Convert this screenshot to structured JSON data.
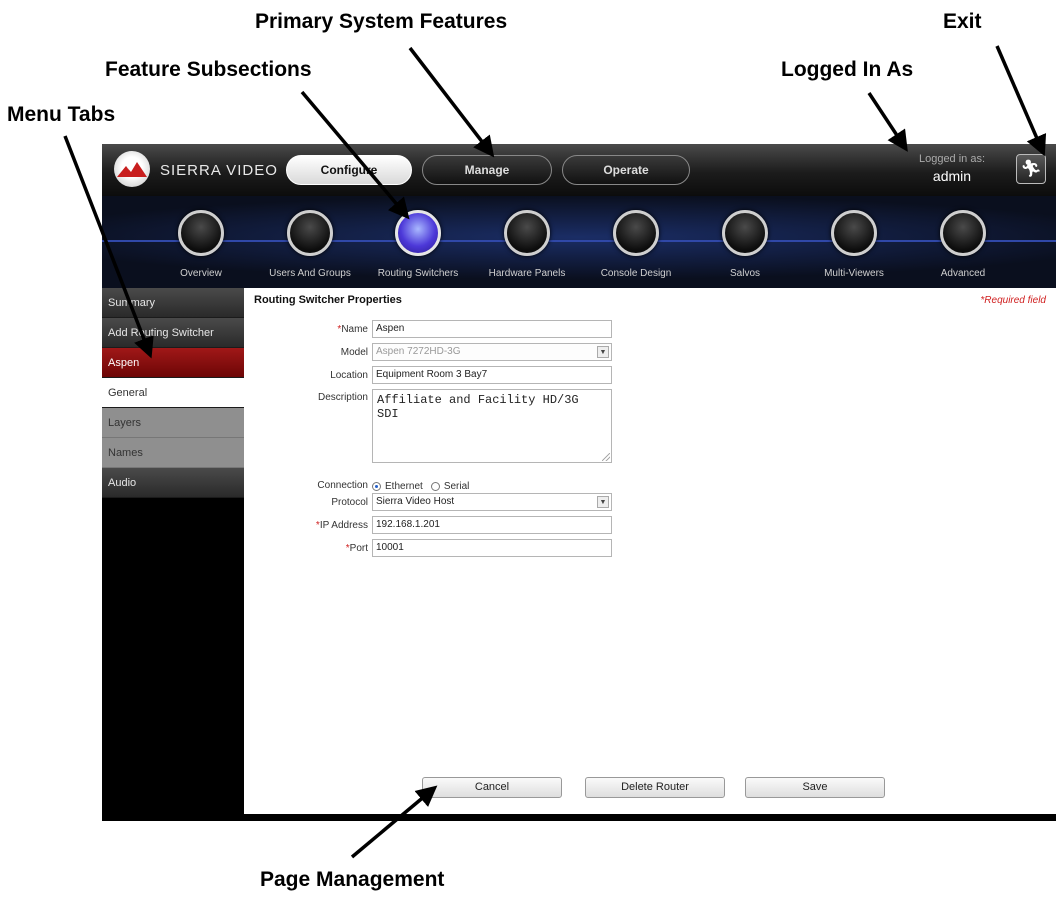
{
  "annotations": {
    "primary_features": "Primary System Features",
    "exit": "Exit",
    "feature_subsections": "Feature Subsections",
    "logged_in_as": "Logged In As",
    "menu_tabs": "Menu Tabs",
    "page_management": "Page Management"
  },
  "header": {
    "brand": "SIERRA VIDEO",
    "logo_icon": "sierra-video-logo",
    "nav": [
      {
        "label": "Configure",
        "active": true
      },
      {
        "label": "Manage",
        "active": false
      },
      {
        "label": "Operate",
        "active": false
      }
    ],
    "logged_in_label": "Logged in as:",
    "username": "admin",
    "exit_icon": "running-man-exit-icon"
  },
  "features": [
    {
      "label": "Overview",
      "active": false
    },
    {
      "label": "Users And Groups",
      "active": false
    },
    {
      "label": "Routing Switchers",
      "active": true
    },
    {
      "label": "Hardware Panels",
      "active": false
    },
    {
      "label": "Console Design",
      "active": false
    },
    {
      "label": "Salvos",
      "active": false
    },
    {
      "label": "Multi-Viewers",
      "active": false
    },
    {
      "label": "Advanced",
      "active": false
    }
  ],
  "sidebar": {
    "items": [
      {
        "label": "Summary",
        "state": "dark"
      },
      {
        "label": "Add Routing Switcher",
        "state": "dark"
      },
      {
        "label": "Aspen",
        "state": "selected"
      },
      {
        "label": "General",
        "state": "active"
      },
      {
        "label": "Layers",
        "state": "gray"
      },
      {
        "label": "Names",
        "state": "gray"
      },
      {
        "label": "Audio",
        "state": "gray-dark"
      }
    ]
  },
  "form": {
    "title": "Routing Switcher Properties",
    "required_note": "*Required field",
    "fields": {
      "name": {
        "label": "Name",
        "required": true,
        "value": "Aspen"
      },
      "model": {
        "label": "Model",
        "value": "Aspen 7272HD-3G"
      },
      "location": {
        "label": "Location",
        "value": "Equipment Room 3 Bay7"
      },
      "description": {
        "label": "Description",
        "value": "Affiliate and Facility HD/3G SDI"
      },
      "connection": {
        "label": "Connection",
        "options": [
          "Ethernet",
          "Serial"
        ],
        "selected": "Ethernet"
      },
      "protocol": {
        "label": "Protocol",
        "value": "Sierra Video Host"
      },
      "ip_address": {
        "label": "IP Address",
        "required": true,
        "value": "192.168.1.201"
      },
      "port": {
        "label": "Port",
        "required": true,
        "value": "10001"
      }
    },
    "required_marker": "*"
  },
  "actions": {
    "cancel": "Cancel",
    "delete": "Delete Router",
    "save": "Save"
  },
  "colors": {
    "accent_red": "#a01818",
    "feature_blue": "#4c38d8",
    "required_red": "#d02020"
  }
}
